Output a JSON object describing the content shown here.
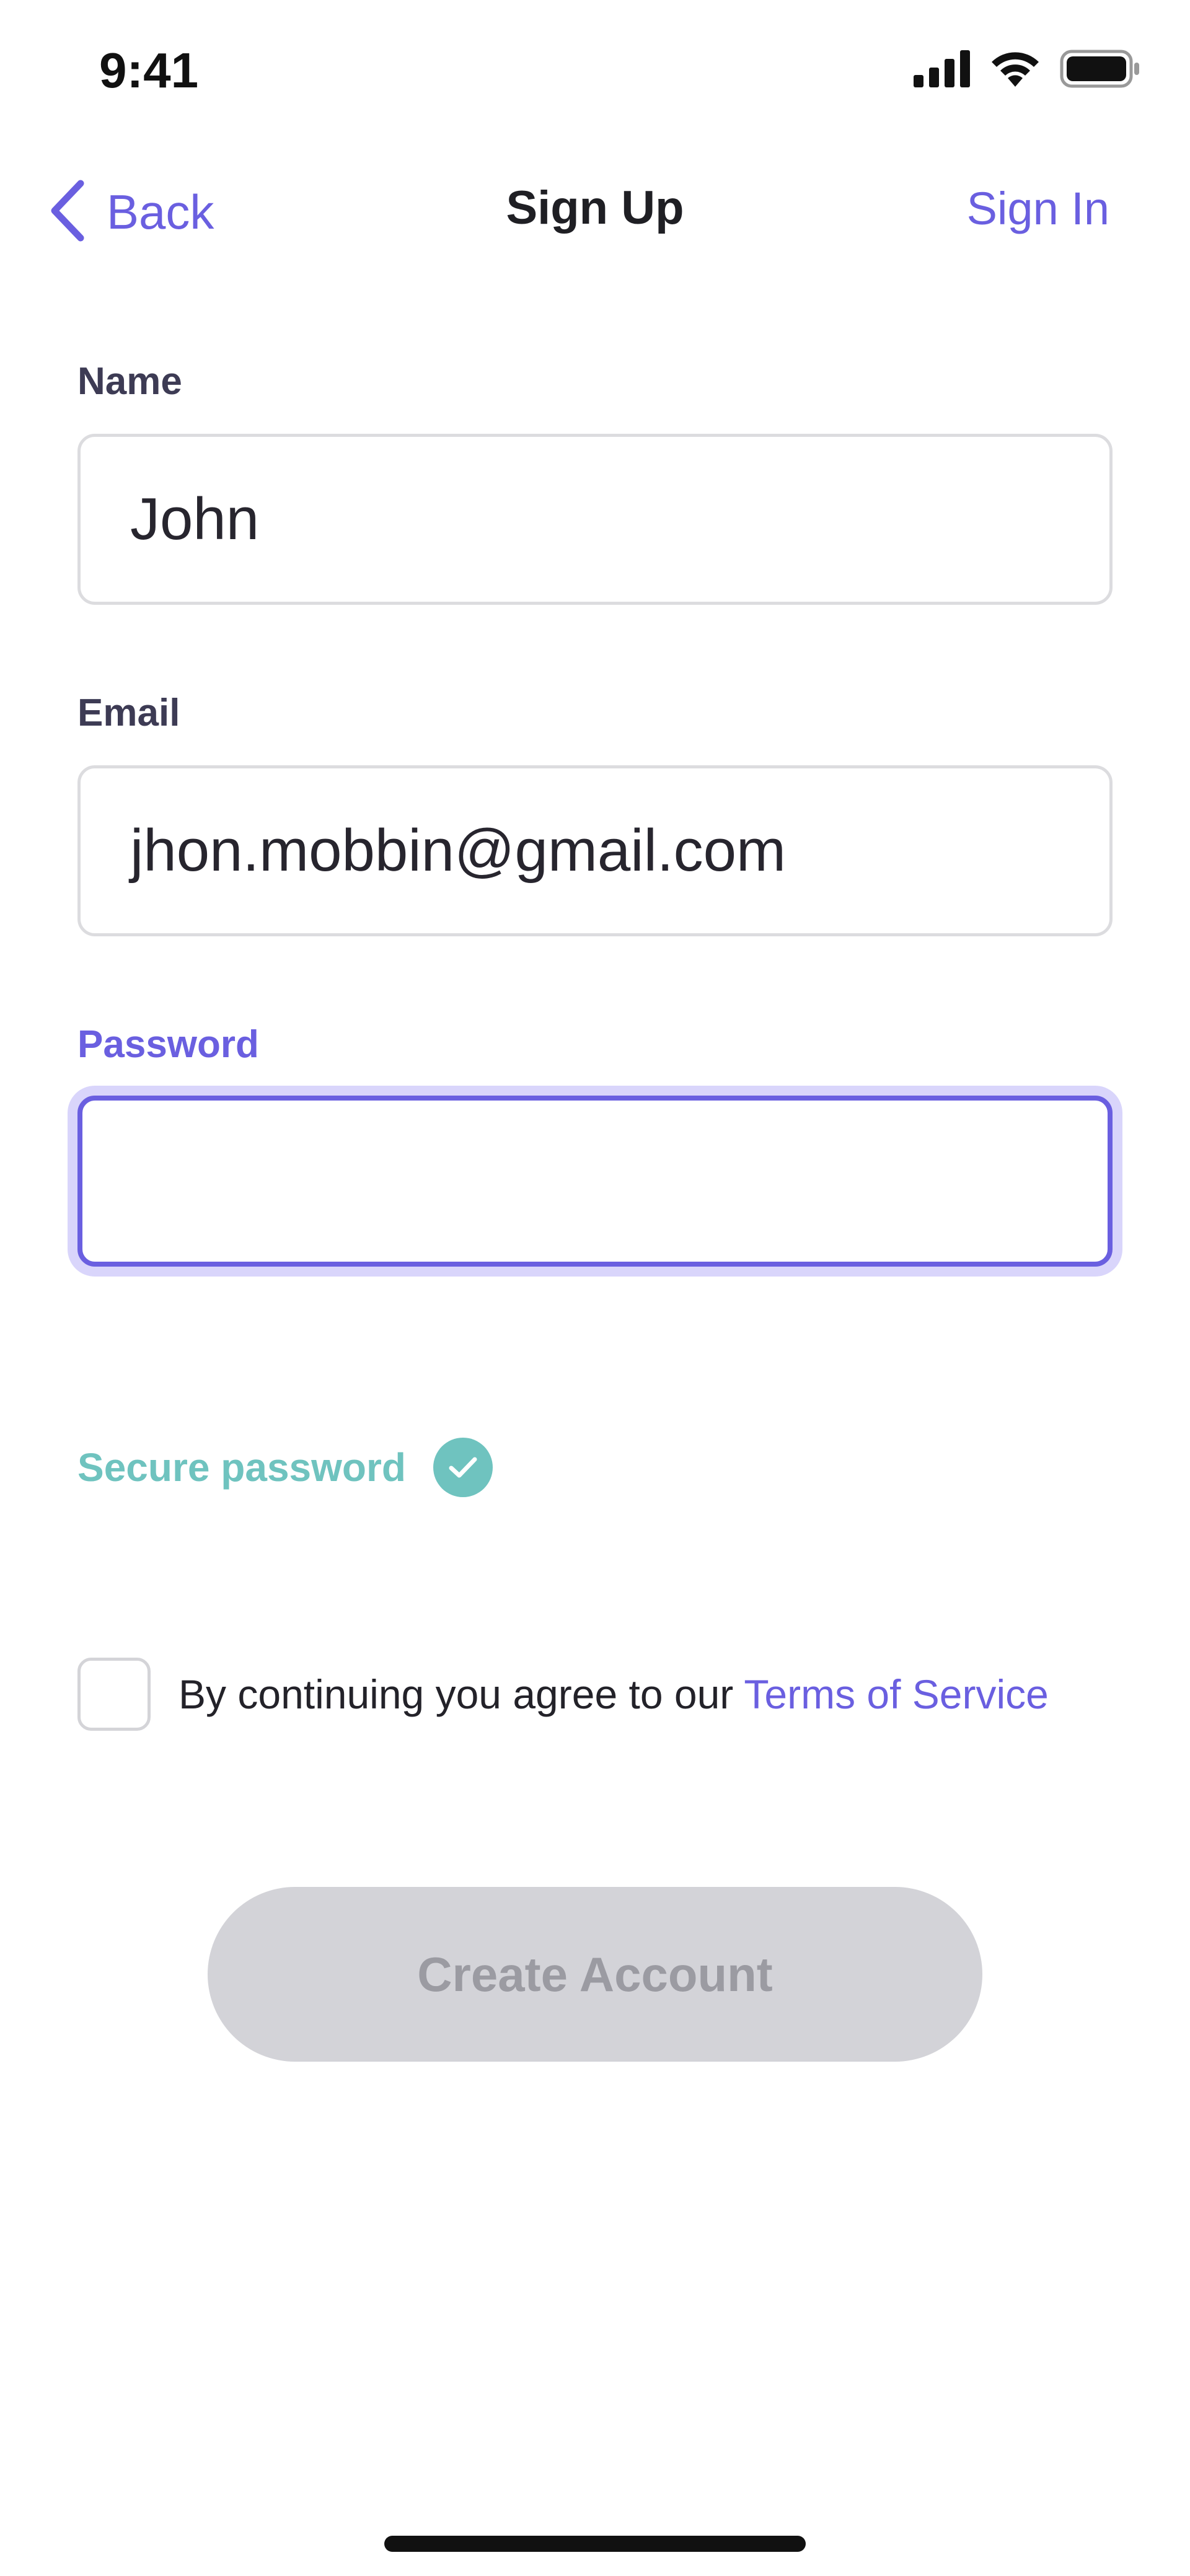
{
  "status_bar": {
    "time": "9:41",
    "icons": [
      "cellular-signal-icon",
      "wifi-icon",
      "battery-icon"
    ]
  },
  "nav": {
    "back_label": "Back",
    "title": "Sign Up",
    "sign_in_label": "Sign In"
  },
  "form": {
    "name_label": "Name",
    "name_value": "John",
    "email_label": "Email",
    "email_value": "jhon.mobbin@gmail.com",
    "password_label": "Password",
    "password_value": "",
    "password_strength_text": "Secure password"
  },
  "terms": {
    "checked": false,
    "prefix": "By continuing you agree to our ",
    "link_text": "Terms of Service"
  },
  "actions": {
    "create_account_label": "Create Account",
    "create_account_enabled": false
  },
  "colors": {
    "accent": "#6a5fe0",
    "success": "#6fc3bf",
    "disabled_button_bg": "#d3d3d8",
    "disabled_button_text": "#9b9ba2"
  }
}
